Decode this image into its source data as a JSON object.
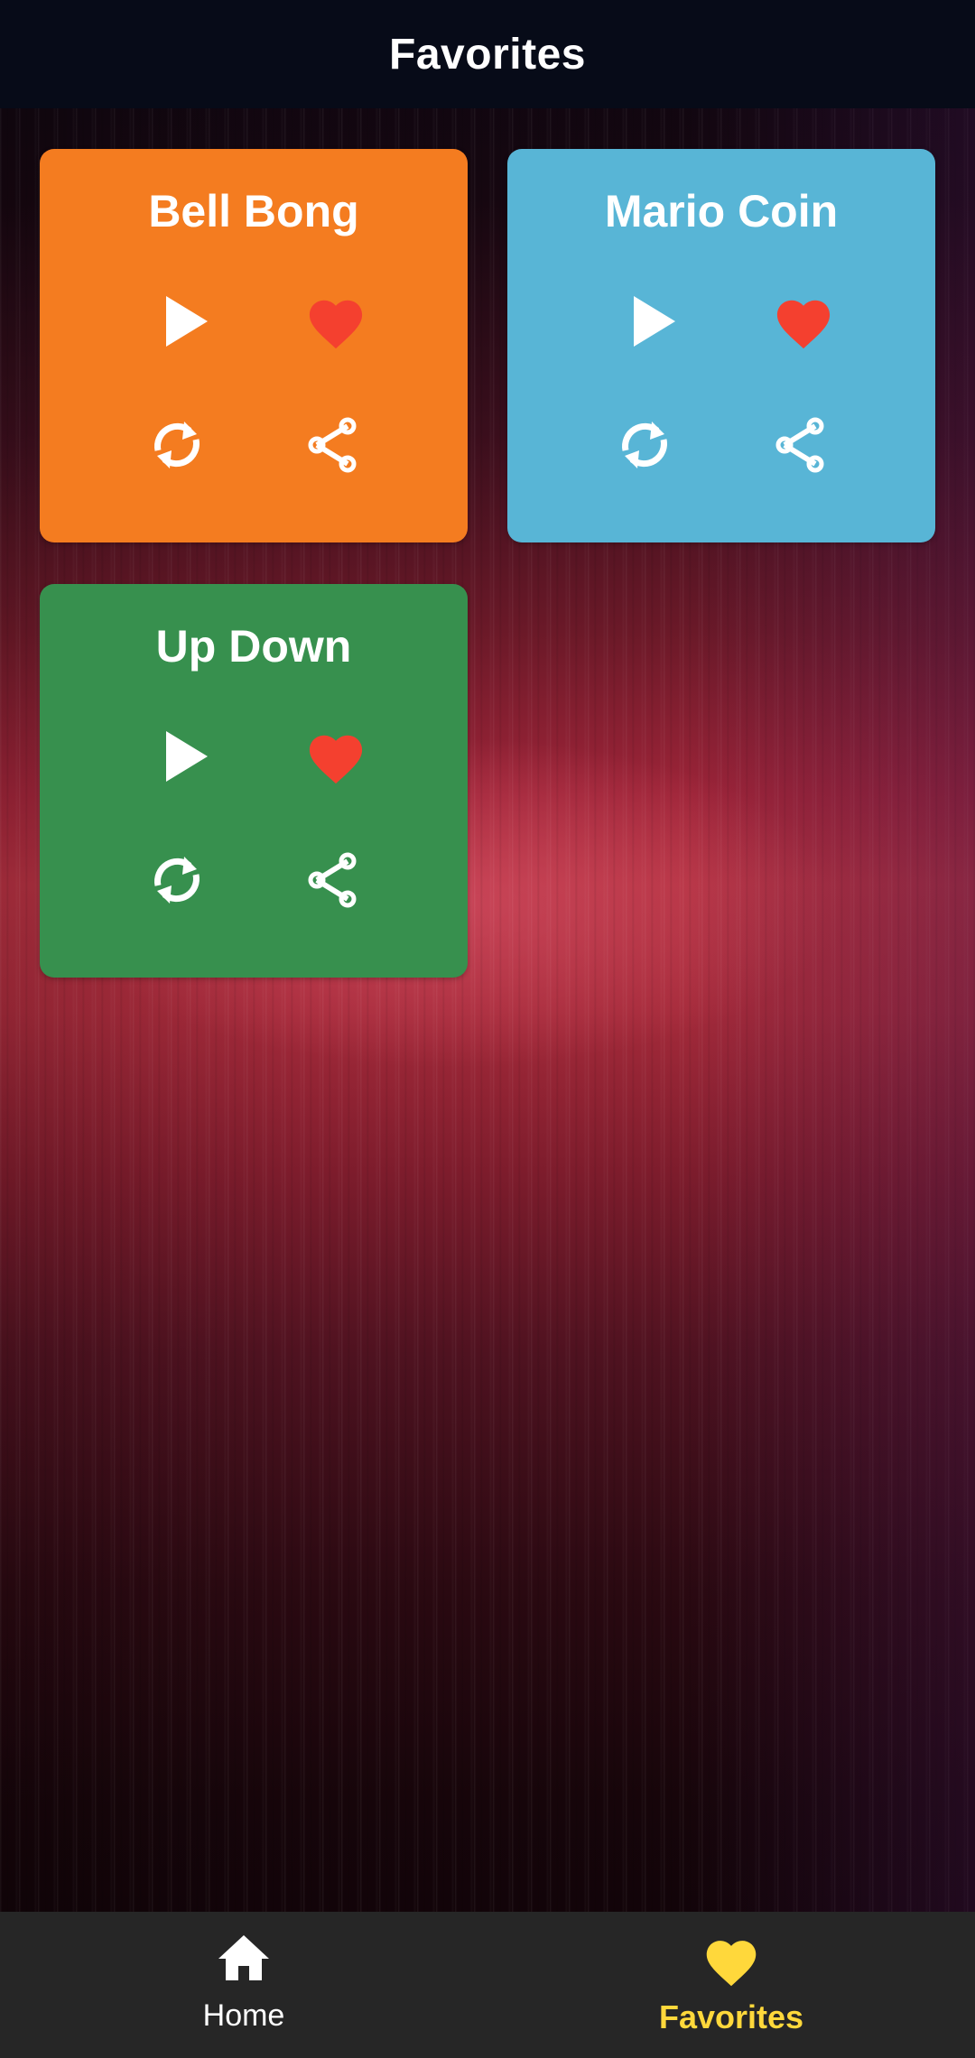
{
  "header": {
    "title": "Favorites"
  },
  "cards": [
    {
      "title": "Bell Bong",
      "color": "#f47c20"
    },
    {
      "title": "Mario Coin",
      "color": "#58b5d6"
    },
    {
      "title": "Up Down",
      "color": "#37904e"
    }
  ],
  "icons": {
    "play": "play-icon",
    "favorite": "heart-icon",
    "loop": "repeat-icon",
    "share": "share-icon"
  },
  "colors": {
    "heart": "#f4402f",
    "icon": "#ffffff",
    "nav_active": "#ffd83b",
    "nav_inactive": "#ffffff",
    "nav_background": "#262626",
    "header_background": "#070b18"
  },
  "bottom_nav": {
    "items": [
      {
        "label": "Home",
        "icon": "home-icon",
        "active": false
      },
      {
        "label": "Favorites",
        "icon": "heart-icon",
        "active": true
      }
    ]
  }
}
